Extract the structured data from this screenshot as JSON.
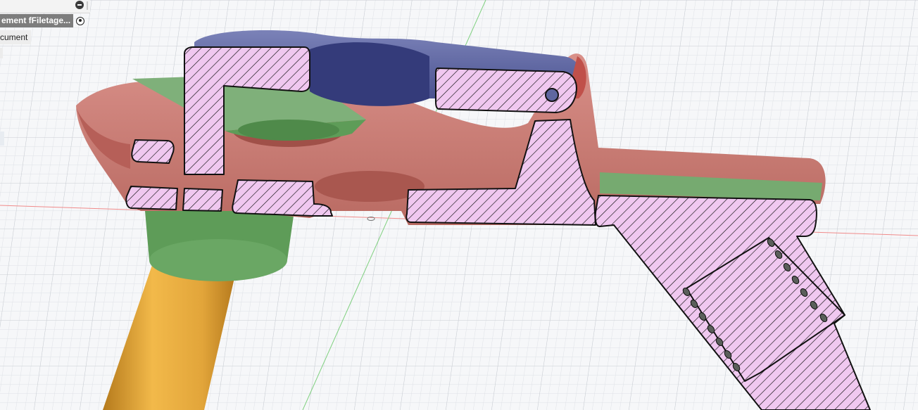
{
  "browser": {
    "component_label": "ement fFiletage...",
    "document_label": "cument"
  },
  "colors": {
    "background": "#f6f7f9",
    "section_fill": "#f0c8f0",
    "body_red": "#c97c75",
    "body_green": "#7fb07a",
    "body_blue": "#5f67a0",
    "body_yellow": "#e2a53a",
    "hatch": "#111111"
  },
  "icons": {
    "visibility": "visibility-toggle-icon",
    "activate": "radio-activate-icon",
    "origin": "origin-marker-icon"
  }
}
